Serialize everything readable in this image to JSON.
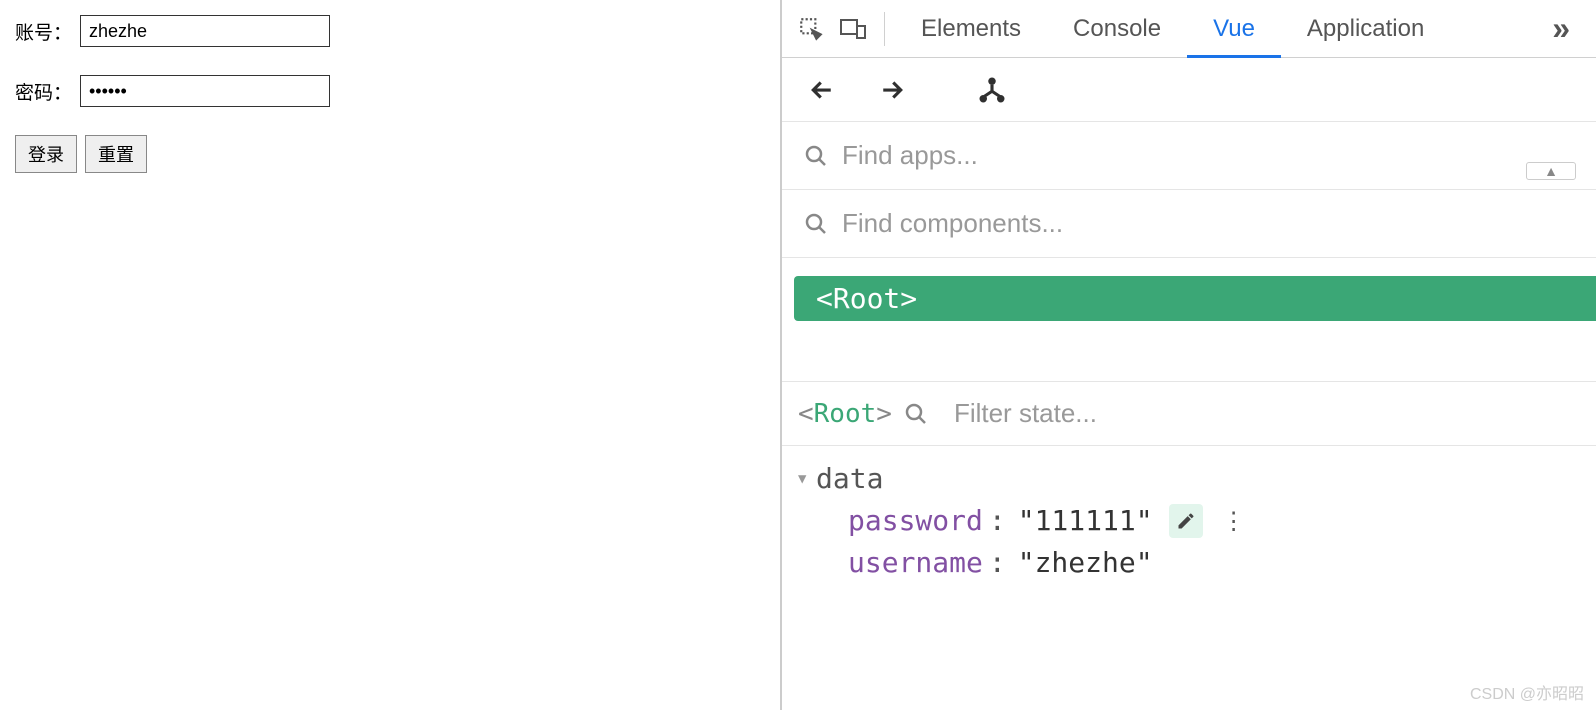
{
  "form": {
    "username_label": "账号：",
    "username_value": "zhezhe",
    "password_label": "密码：",
    "password_value": "••••••",
    "login_button": "登录",
    "reset_button": "重置"
  },
  "devtools": {
    "tabs": {
      "elements": "Elements",
      "console": "Console",
      "vue": "Vue",
      "application": "Application"
    },
    "more_symbol": "»"
  },
  "vue_panel": {
    "find_apps_placeholder": "Find apps...",
    "find_components_placeholder": "Find components...",
    "root_node": "<Root>",
    "state_root_label": "Root",
    "filter_state_placeholder": "Filter state...",
    "data_section_title": "data",
    "props": {
      "password_key": "password",
      "password_val": "\"111111\"",
      "username_key": "username",
      "username_val": "\"zhezhe\""
    }
  },
  "watermark": "CSDN @亦昭昭"
}
